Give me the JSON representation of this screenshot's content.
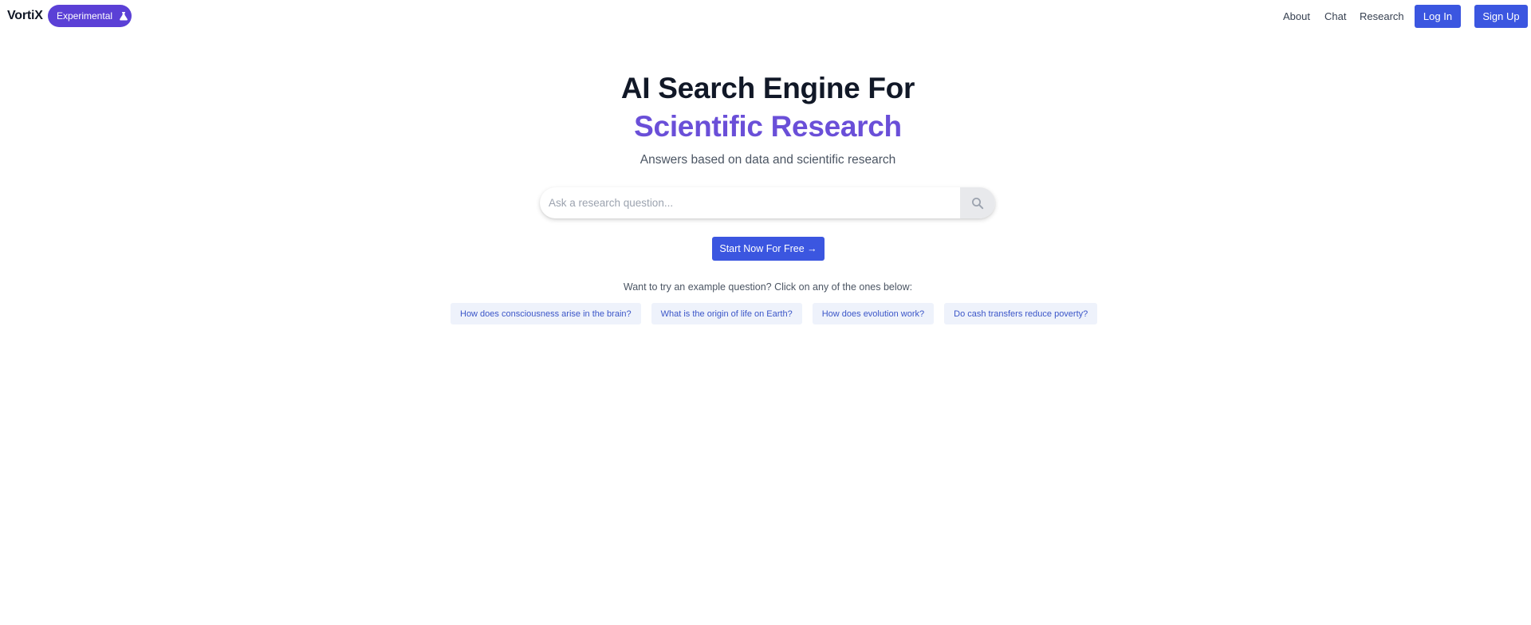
{
  "header": {
    "brand": "VortiX",
    "badge": {
      "label": "Experimental",
      "icon": "flask-icon"
    },
    "nav": [
      {
        "label": "About"
      },
      {
        "label": "Chat"
      },
      {
        "label": "Research"
      }
    ],
    "login_label": "Log In",
    "signup_label": "Sign Up"
  },
  "hero": {
    "title_line1": "AI Search Engine For",
    "title_line2": "Scientific Research",
    "subtitle": "Answers based on data and scientific research"
  },
  "search": {
    "placeholder": "Ask a research question...",
    "value": "",
    "icon": "search-icon"
  },
  "cta": {
    "label": "Start Now For Free →"
  },
  "examples": {
    "prompt": "Want to try an example question? Click on any of the ones below:",
    "items": [
      "How does consciousness arise in the brain?",
      "What is the origin of life on Earth?",
      "How does evolution work?",
      "Do cash transfers reduce poverty?"
    ]
  },
  "colors": {
    "primary": "#3b56e0",
    "badge": "#5b40d6",
    "accent_title": "#6a4fd8",
    "chip_bg": "#eef2fb",
    "chip_text": "#3b56c8"
  }
}
